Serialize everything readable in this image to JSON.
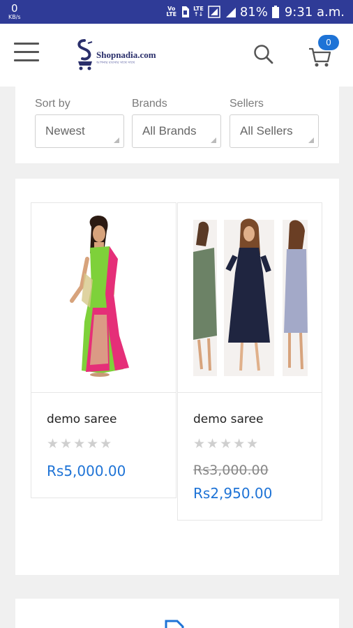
{
  "status_bar": {
    "net_speed": "0",
    "net_unit": "KB/s",
    "volte": "VoLTE",
    "lte": "LTE",
    "battery": "81%",
    "time": "9:31 a.m."
  },
  "header": {
    "logo_text": "Shopnadia.com",
    "logo_tagline": "আপনার ব্যবসার সাথে সাথে",
    "cart_count": "0"
  },
  "filters": [
    {
      "label": "Sort by",
      "value": "Newest"
    },
    {
      "label": "Brands",
      "value": "All Brands"
    },
    {
      "label": "Sellers",
      "value": "All Sellers"
    }
  ],
  "products": [
    {
      "name": "demo saree",
      "rating": 0,
      "stars": "★★★★★",
      "price": "Rs5,000.00"
    },
    {
      "name": "demo saree",
      "rating": 0,
      "stars": "★★★★★",
      "old_price": "Rs3,000.00",
      "price": "Rs2,950.00"
    }
  ],
  "colors": {
    "status_bar": "#2f3b97",
    "accent": "#1e73d6",
    "saree_green": "#7ed13a",
    "saree_pink": "#e52f78"
  }
}
